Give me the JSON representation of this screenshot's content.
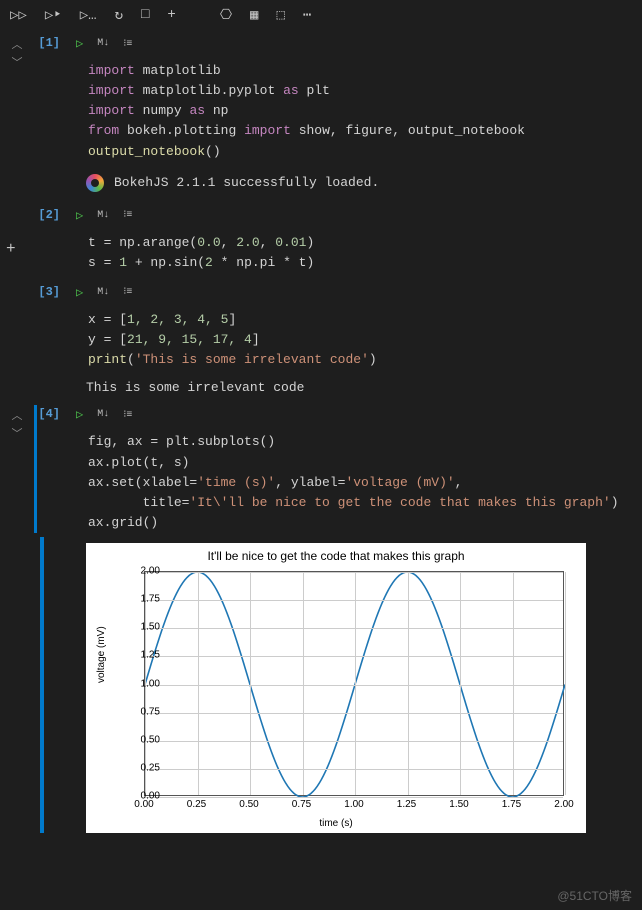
{
  "toolbar": {
    "run_all": "▷▷",
    "run_next": "▷‣",
    "run_below": "▷…",
    "restart": "↻",
    "stop": "□",
    "add": "+",
    "var": "⎔",
    "grid": "▦",
    "export": "⬚",
    "more": "⋯"
  },
  "cells": [
    {
      "label": "[1]",
      "toolbar": {
        "run": "▷",
        "md": "M↓",
        "menu": "⁝≡"
      },
      "output": "BokehJS 2.1.1 successfully loaded."
    },
    {
      "label": "[2]",
      "toolbar": {
        "run": "▷",
        "md": "M↓",
        "menu": "⁝≡"
      }
    },
    {
      "label": "[3]",
      "toolbar": {
        "run": "▷",
        "md": "M↓",
        "menu": "⁝≡"
      },
      "output": "This is some irrelevant code"
    },
    {
      "label": "[4]",
      "toolbar": {
        "run": "▷",
        "md": "M↓",
        "menu": "⁝≡"
      }
    }
  ],
  "code": {
    "c1l1a": "import",
    "c1l1b": "matplotlib",
    "c1l2a": "import",
    "c1l2b": "matplotlib.pyplot",
    "c1l2c": "as",
    "c1l2d": "plt",
    "c1l3a": "import",
    "c1l3b": "numpy",
    "c1l3c": "as",
    "c1l3d": "np",
    "c1l4a": "from",
    "c1l4b": "bokeh.plotting",
    "c1l4c": "import",
    "c1l4d": "show, figure, output_notebook",
    "c1l5a": "output_notebook",
    "c1l5b": "()",
    "c2l1": "t = np.arange(",
    "c2l1n1": "0.0",
    "c2l1s1": ", ",
    "c2l1n2": "2.0",
    "c2l1s2": ", ",
    "c2l1n3": "0.01",
    "c2l1e": ")",
    "c2l2": "s = ",
    "c2l2n1": "1",
    "c2l2m": " + np.sin(",
    "c2l2n2": "2",
    "c2l2m2": " * np.pi * t)",
    "c3l1": "x = [",
    "c3l1v": "1, 2, 3, 4, 5",
    "c3l1e": "]",
    "c3l2": "y = [",
    "c3l2v": "21, 9, 15, 17, 4",
    "c3l2e": "]",
    "c3l3a": "print",
    "c3l3b": "(",
    "c3l3s": "'This is some irrelevant code'",
    "c3l3e": ")",
    "c4l1": "fig, ax = plt.subplots()",
    "c4l2": "ax.plot(t, s)",
    "c4l3a": "ax.set(xlabel=",
    "c4l3s1": "'time (s)'",
    "c4l3m": ", ylabel=",
    "c4l3s2": "'voltage (mV)'",
    "c4l3e": ",",
    "c4l4a": "       title=",
    "c4l4s": "'It\\'ll be nice to get the code that makes this graph'",
    "c4l4e": ")",
    "c4l5": "ax.grid()"
  },
  "chart_data": {
    "type": "line",
    "title": "It'll be nice to get the code that makes this graph",
    "xlabel": "time (s)",
    "ylabel": "voltage (mV)",
    "xlim": [
      0.0,
      2.0
    ],
    "ylim": [
      0.0,
      2.0
    ],
    "xticks": [
      0.0,
      0.25,
      0.5,
      0.75,
      1.0,
      1.25,
      1.5,
      1.75,
      2.0
    ],
    "yticks": [
      0.0,
      0.25,
      0.5,
      0.75,
      1.0,
      1.25,
      1.5,
      1.75,
      2.0
    ],
    "series": [
      {
        "name": "s",
        "formula": "1 + sin(2*pi*t)",
        "x_start": 0.0,
        "x_end": 2.0,
        "x_step": 0.01,
        "color": "#1f77b4"
      }
    ]
  },
  "watermark": "@51CTO博客"
}
